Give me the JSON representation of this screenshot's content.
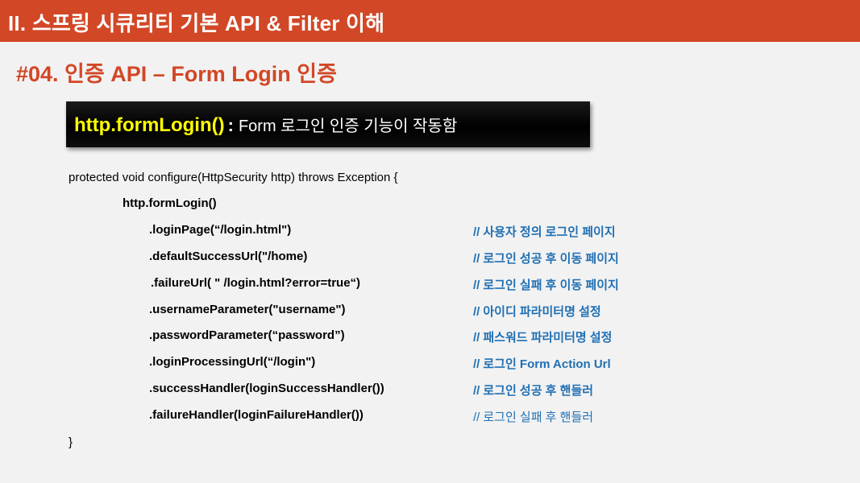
{
  "header": {
    "title": "II. 스프링 시큐리티 기본 API & Filter 이해"
  },
  "section": {
    "title": "#04. 인증 API – Form Login 인증"
  },
  "banner": {
    "code": "http.formLogin()",
    "separator": ":",
    "description": "Form 로그인 인증 기능이 작동함"
  },
  "code": {
    "signature": "protected  void configure(HttpSecurity  http)  throws Exception {",
    "call": "http.formLogin()",
    "closing_brace": "}",
    "lines": [
      {
        "code": ".loginPage(“/login.html\")",
        "comment_prefix": "//",
        "comment": "사용자 정의 로그인 페이지"
      },
      {
        "code": ".defaultSuccessUrl(\"/home)",
        "comment_prefix": "//",
        "comment": "로그인 성공 후 이동 페이지"
      },
      {
        "code": ".failureUrl( \" /login.html?error=true“)",
        "comment_prefix": "//",
        "comment": "로그인 실패 후 이동 페이지"
      },
      {
        "code": ".usernameParameter(\"username\")",
        "comment_prefix": "//",
        "comment": "아이디 파라미터명 설정"
      },
      {
        "code": ".passwordParameter(“password”)",
        "comment_prefix": "//",
        "comment": "패스워드 파라미터명 설정"
      },
      {
        "code": ".loginProcessingUrl(“/login\")",
        "comment_prefix": "//",
        "comment": "로그인 Form Action Url"
      },
      {
        "code": ".successHandler(loginSuccessHandler())",
        "comment_prefix": "//",
        "comment": "로그인 성공 후 핸들러"
      },
      {
        "code": ".failureHandler(loginFailureHandler())",
        "comment_prefix": "//",
        "comment": "로그인 실패 후 핸들러"
      }
    ]
  },
  "colors": {
    "accent": "#d24726",
    "banner_code": "#ffff00",
    "comment": "#1f6fb3"
  }
}
